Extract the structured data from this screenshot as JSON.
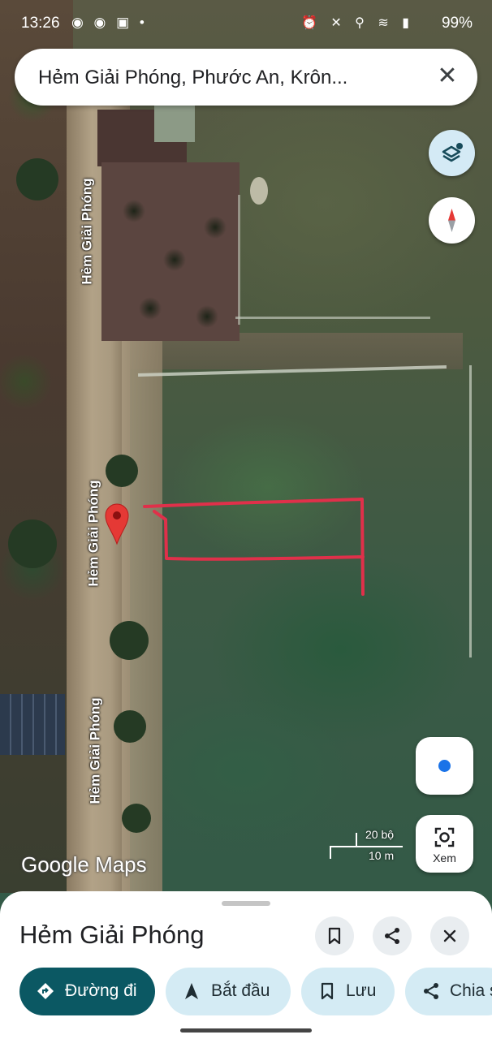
{
  "status_bar": {
    "time": "13:26",
    "notifications": "◉ ◉ ▣ •",
    "system_icons": "⏰ ✕ ⚲ ≋ ▮",
    "battery": "99%"
  },
  "search": {
    "text": "Hẻm Giải Phóng, Phước An, Krôn..."
  },
  "map": {
    "road_labels": [
      "Hẻm Giải Phóng",
      "Hẻm Giải Phóng",
      "Hẻm Giải Phóng"
    ],
    "scale_top": "20 bộ",
    "scale_bottom": "10 m",
    "logo": "Google Maps",
    "lens_label": "Xem"
  },
  "sheet": {
    "title": "Hẻm Giải Phóng",
    "chips": [
      {
        "label": "Đường đi"
      },
      {
        "label": "Bắt đầu"
      },
      {
        "label": "Lưu"
      },
      {
        "label": "Chia s"
      }
    ]
  },
  "colors": {
    "pin": "#e53935",
    "scribble": "#e0304a",
    "primary_chip": "#0b5863",
    "chip": "#d4ebf4"
  }
}
